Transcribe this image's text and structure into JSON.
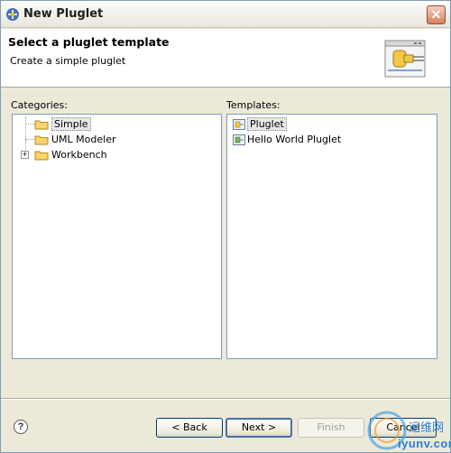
{
  "window": {
    "title": "New Pluglet"
  },
  "banner": {
    "title": "Select a pluglet template",
    "subtitle": "Create a simple pluglet"
  },
  "categories": {
    "label": "Categories:",
    "items": [
      {
        "label": "Simple",
        "selected": true,
        "expandable": false
      },
      {
        "label": "UML Modeler",
        "selected": false,
        "expandable": false
      },
      {
        "label": "Workbench",
        "selected": false,
        "expandable": true
      }
    ]
  },
  "templates": {
    "label": "Templates:",
    "items": [
      {
        "label": "Pluglet",
        "selected": true
      },
      {
        "label": "Hello World Pluglet",
        "selected": false
      }
    ]
  },
  "buttons": {
    "back": "< Back",
    "next": "Next >",
    "finish": "Finish",
    "cancel": "Cancel"
  },
  "help": {
    "glyph": "?"
  },
  "watermark": {
    "brand": "iyunv.com",
    "cn": "运维网"
  },
  "icons": {
    "app": "eclipse-icon",
    "folder": "folder-icon",
    "template": "template-icon",
    "close": "close-icon",
    "help": "help-icon"
  },
  "colors": {
    "accent_border": "#7f9db9",
    "dialog_bg": "#ece9d8",
    "close_red": "#d8805f"
  }
}
